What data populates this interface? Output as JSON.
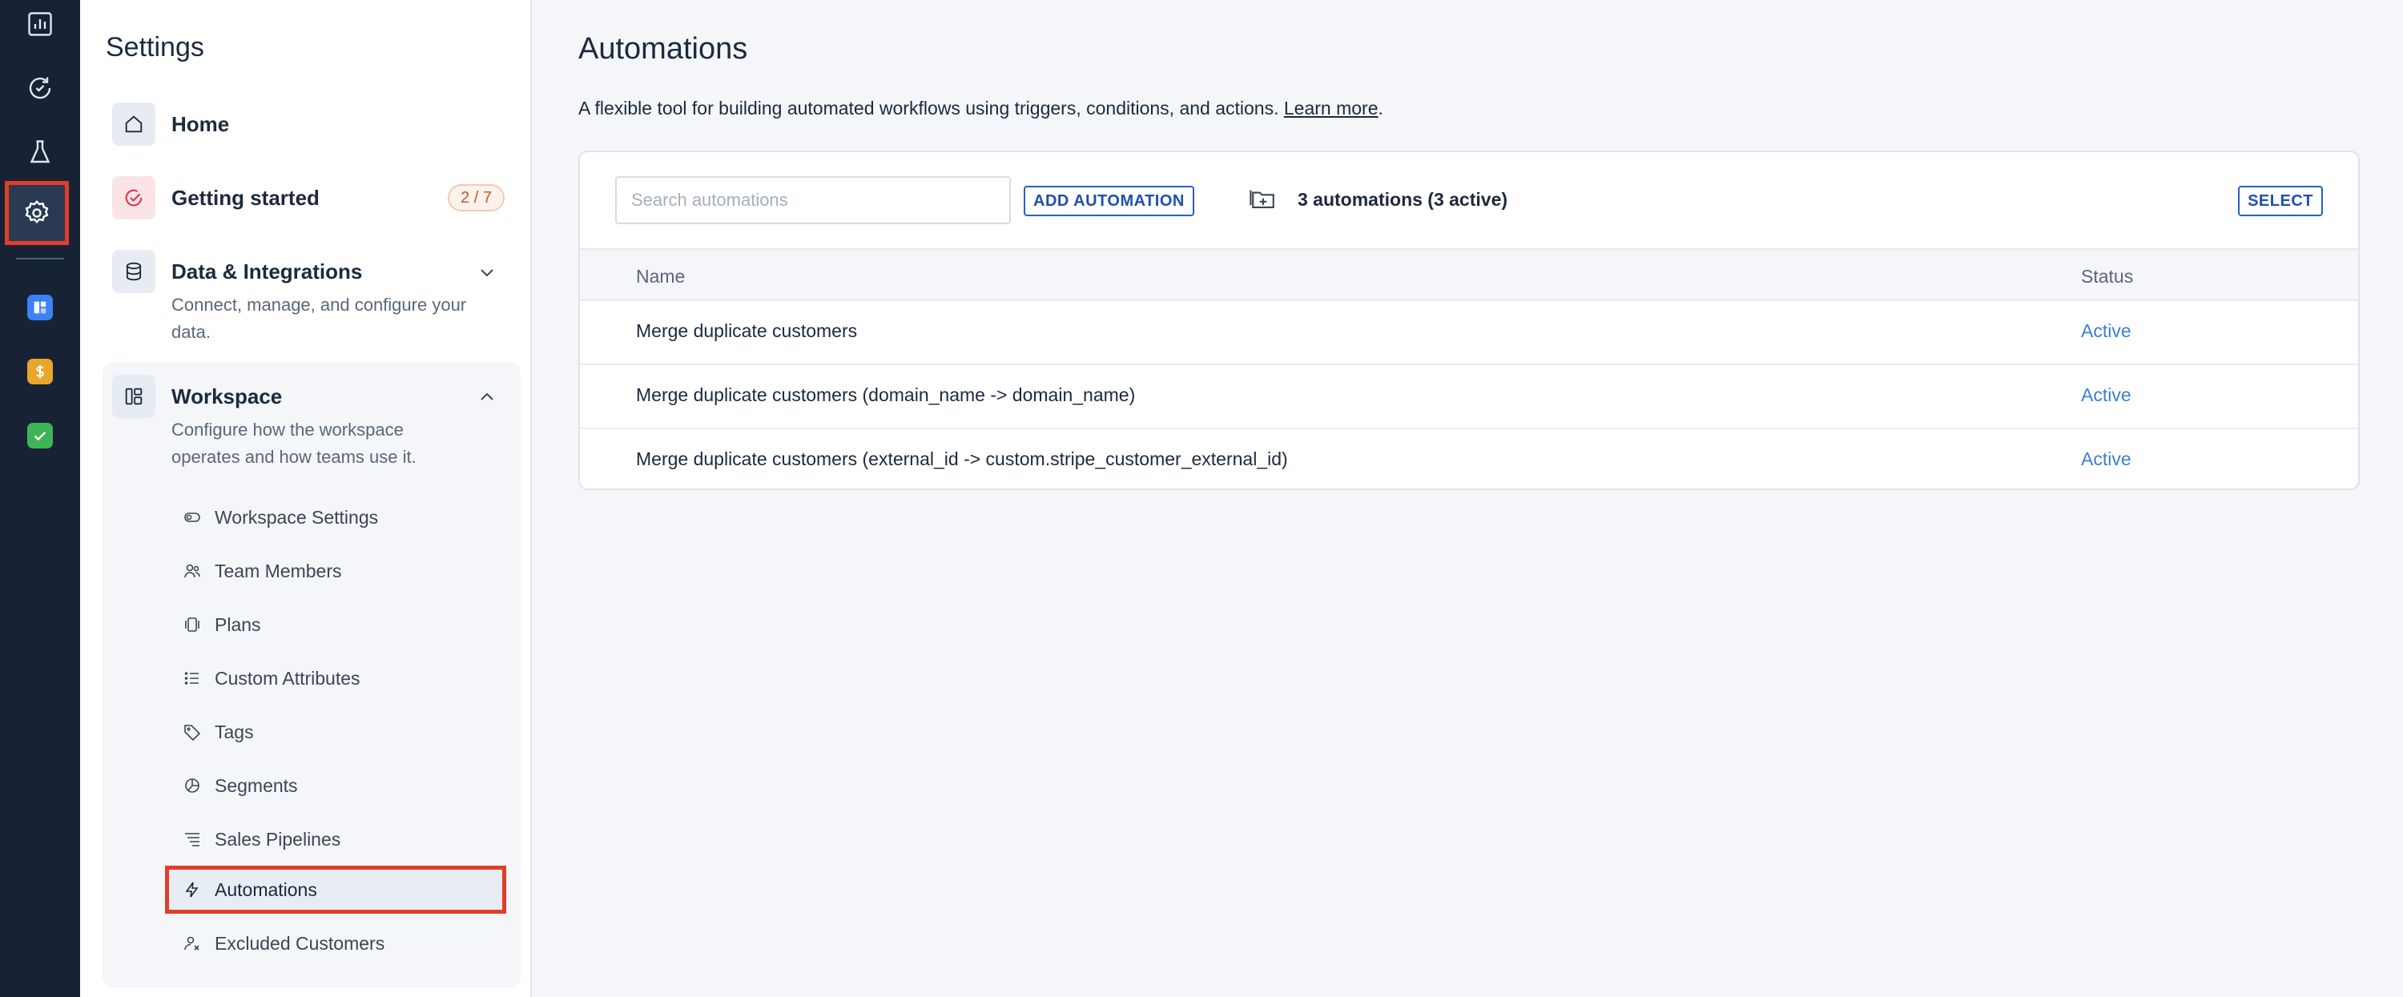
{
  "rail": {
    "items": [
      {
        "name": "analytics",
        "icon": "bar-chart-icon"
      },
      {
        "name": "activity",
        "icon": "refresh-circle-icon"
      },
      {
        "name": "labs",
        "icon": "flask-icon"
      },
      {
        "name": "settings",
        "icon": "gear-icon",
        "selected": true
      }
    ],
    "apps": [
      {
        "name": "board",
        "color": "#3b82f6"
      },
      {
        "name": "billing",
        "color": "#e8a62b"
      },
      {
        "name": "tasks",
        "color": "#3fb457"
      }
    ]
  },
  "sidebar": {
    "title": "Settings",
    "home": {
      "label": "Home"
    },
    "getting_started": {
      "label": "Getting started",
      "badge": "2 / 7"
    },
    "data_integrations": {
      "label": "Data & Integrations",
      "desc": "Connect, manage, and configure your data."
    },
    "workspace": {
      "label": "Workspace",
      "desc": "Configure how the workspace operates and how teams use it.",
      "items": [
        {
          "label": "Workspace Settings"
        },
        {
          "label": "Team Members"
        },
        {
          "label": "Plans"
        },
        {
          "label": "Custom Attributes"
        },
        {
          "label": "Tags"
        },
        {
          "label": "Segments"
        },
        {
          "label": "Sales Pipelines"
        },
        {
          "label": "Automations"
        },
        {
          "label": "Excluded Customers"
        }
      ]
    }
  },
  "main": {
    "title": "Automations",
    "desc": "A flexible tool for building automated workflows using triggers, conditions, and actions.",
    "learn_more": "Learn more",
    "search_placeholder": "Search automations",
    "add_button": "ADD AUTOMATION",
    "count": "3 automations (3 active)",
    "select_button": "SELECT",
    "columns": {
      "name": "Name",
      "status": "Status"
    },
    "rows": [
      {
        "name": "Merge duplicate customers",
        "status": "Active"
      },
      {
        "name": "Merge duplicate customers (domain_name -> domain_name)",
        "status": "Active"
      },
      {
        "name": "Merge duplicate customers (external_id -> custom.stripe_customer_external_id)",
        "status": "Active"
      }
    ]
  },
  "colors": {
    "rail_bg": "#172335",
    "highlight": "#e23d28",
    "accent": "#2b5fc0",
    "status_active": "#3a7fd5"
  }
}
